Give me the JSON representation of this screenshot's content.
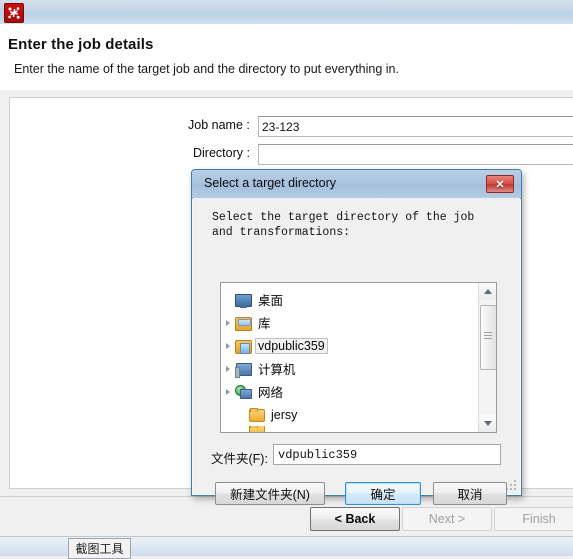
{
  "window": {
    "app_icon": "kettle-spoon-icon"
  },
  "header": {
    "title": "Enter the job details",
    "subtitle": "Enter the name of the target job and the directory to put everything in."
  },
  "form": {
    "job_name_label": "Job name :",
    "job_name_value": "23-123",
    "directory_label": "Directory :",
    "directory_value": "",
    "directory_placeholder": ""
  },
  "wizard_buttons": {
    "back": "< Back",
    "next": "Next >",
    "finish": "Finish"
  },
  "taskbar": {
    "item": "截图工具"
  },
  "dialog": {
    "title": "Select a target directory",
    "close_icon": "close-x-icon",
    "instruction": "Select the target directory of the job and transformations:",
    "tree": [
      {
        "label": "桌面",
        "icon": "desktop-icon",
        "expandable": false,
        "indent": 0,
        "selected": false
      },
      {
        "label": "库",
        "icon": "library-icon",
        "expandable": true,
        "indent": 0,
        "selected": false
      },
      {
        "label": "vdpublic359",
        "icon": "user-icon",
        "expandable": true,
        "indent": 0,
        "selected": true
      },
      {
        "label": "计算机",
        "icon": "computer-icon",
        "expandable": true,
        "indent": 0,
        "selected": false
      },
      {
        "label": "网络",
        "icon": "network-icon",
        "expandable": true,
        "indent": 0,
        "selected": false
      },
      {
        "label": "jersy",
        "icon": "folder-icon",
        "expandable": false,
        "indent": 1,
        "selected": false
      }
    ],
    "folder_label": "文件夹(F):",
    "folder_value": "vdpublic359",
    "buttons": {
      "new_folder": "新建文件夹(N)",
      "ok": "确定",
      "cancel": "取消"
    }
  },
  "colors": {
    "titlebar_blue": "#a9c3de",
    "accent_blue": "#2f93d6",
    "app_red": "#cc1111",
    "close_red": "#d9534c"
  }
}
